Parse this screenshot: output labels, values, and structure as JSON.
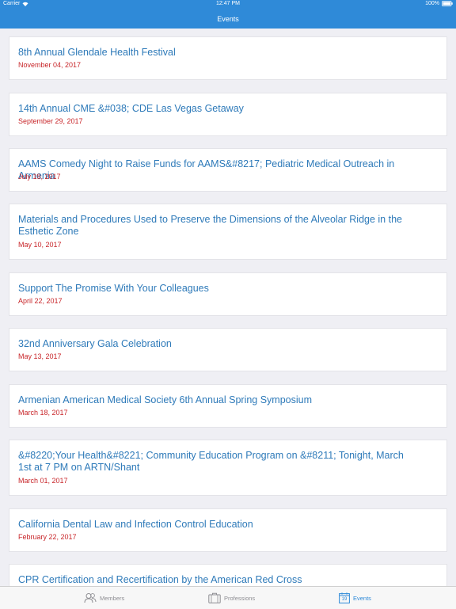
{
  "status_bar": {
    "carrier": "Carrier",
    "time": "12:47 PM",
    "battery": "100%"
  },
  "nav": {
    "title": "Events"
  },
  "events": [
    {
      "title": "8th Annual Glendale Health Festival",
      "date": "November 04, 2017"
    },
    {
      "title": "14th Annual CME &#038; CDE Las Vegas Getaway",
      "date": "September 29, 2017"
    },
    {
      "title": "AAMS Comedy Night to Raise Funds for AAMS&#8217; Pediatric Medical Outreach in Armenia",
      "date": "July 19, 2017"
    },
    {
      "title": "Materials and Procedures Used to Preserve the Dimensions of the Alveolar Ridge in the Esthetic Zone",
      "date": "May 10, 2017"
    },
    {
      "title": "Support The Promise With Your Colleagues",
      "date": "April 22, 2017"
    },
    {
      "title": "32nd Anniversary Gala Celebration",
      "date": "May 13, 2017"
    },
    {
      "title": "Armenian American Medical Society 6th Annual Spring Symposium",
      "date": "March 18, 2017"
    },
    {
      "title": "&#8220;Your Health&#8221; Community Education Program on &#8211; Tonight, March 1st at 7 PM on ARTN/Shant",
      "date": "March 01, 2017"
    },
    {
      "title": "California Dental Law and Infection Control Education",
      "date": "February 22, 2017"
    },
    {
      "title": "CPR Certification and Recertification by the American Red Cross",
      "date": ""
    }
  ],
  "tabs": {
    "members": {
      "label": "Members",
      "icon": "members-icon"
    },
    "professions": {
      "label": "Professions",
      "icon": "briefcase-icon"
    },
    "events": {
      "label": "Events",
      "icon": "calendar-icon",
      "day": "19"
    }
  },
  "colors": {
    "accent": "#2f8ad8",
    "title": "#2e7ab9",
    "date": "#c8262a",
    "background": "#efeff4"
  }
}
